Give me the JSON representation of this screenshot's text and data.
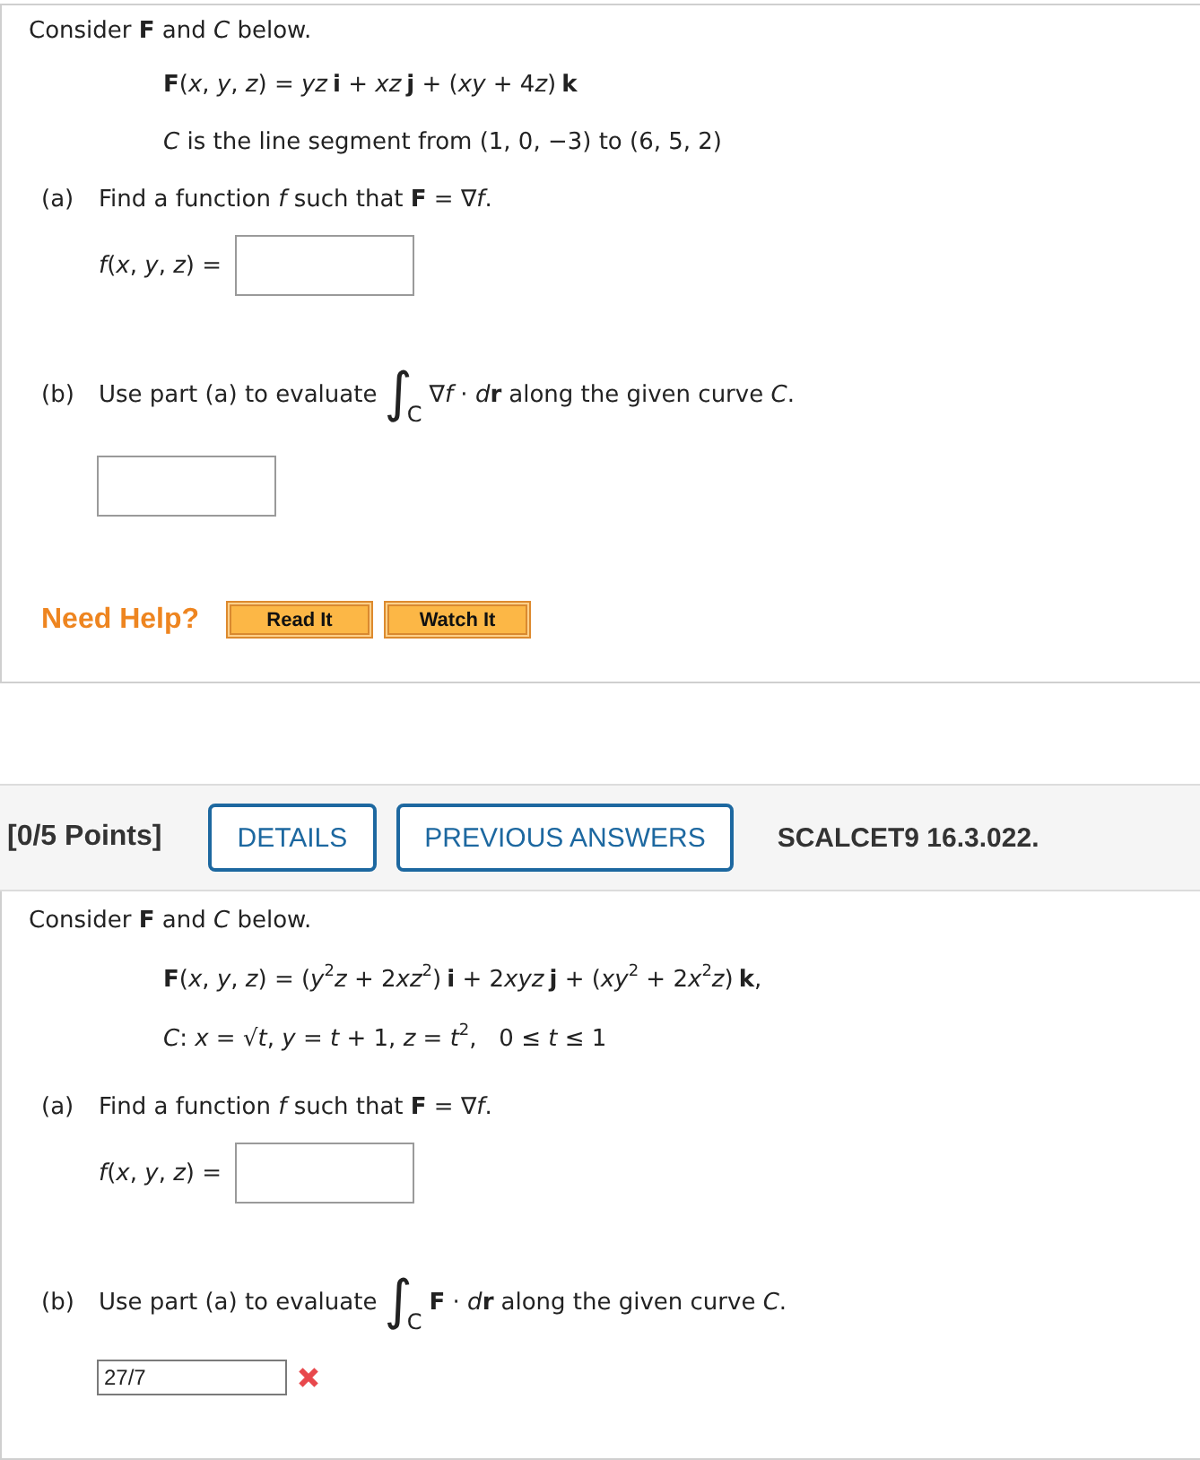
{
  "problems": [
    {
      "intro": "Consider **F** and *C* below.",
      "given": [
        [
          "**F**(*x*, *y*, *z*) = *yz*",
          "**i** + *xz*",
          "**j** + (*xy* + 4",
          "*z*)",
          "**k**"
        ],
        [
          "*C* is the line segment from (1, 0, −3) to (6, 5, 2)"
        ]
      ],
      "parts": [
        {
          "kind": "function",
          "label": "(a)",
          "prompt": "Find a function *f* such that **F** = ∇*f*.",
          "answer_label": "*f*(*x*, *y*, *z*) =",
          "incorrect": false
        },
        {
          "kind": "integral",
          "label": "(b)",
          "prompt": "Use part (a) to evaluate",
          "integral": "∫$_{C}$",
          "integrand": [
            "∇*f* · *d*",
            "**r**"
          ],
          "prompt_end": "along the given curve *C*.",
          "incorrect": false
        }
      ],
      "help": {
        "title": "Need Help?",
        "buttons": [
          "Read It",
          "Watch It"
        ]
      }
    },
    {
      "header": {
        "points": "[0/5 Points]",
        "buttons": [
          "DETAILS",
          "PREVIOUS ANSWERS"
        ],
        "code": "SCALCET9 16.3.022."
      },
      "intro": "Consider **F** and *C* below.",
      "given": [
        [
          "**F**(*x*, *y*, *z*) = (*y*$^{2}$*z* + 2",
          "*xz*$^{2}$)",
          "**i** + 2",
          "*xyz*",
          "**j** + (*xy*$^{2}$ + 2",
          "*x*$^{2}$*z*)",
          "**k**,"
        ],
        [
          "*C*: *x* = √*t*, *y* = *t* + 1, *z* = *t*$^{2}$,   0 ≤ *t* ≤ 1"
        ]
      ],
      "parts": [
        {
          "kind": "function",
          "label": "(a)",
          "prompt": "Find a function *f* such that **F** = ∇*f*.",
          "answer_label": "*f*(*x*, *y*, *z*) =",
          "incorrect": false
        },
        {
          "kind": "integral",
          "label": "(b)",
          "prompt": "Use part (a) to evaluate",
          "integral": "∫$_{C}$",
          "integrand": [
            "**F** · *d*",
            "**r**"
          ],
          "prompt_end": "along the given curve *C*.",
          "answer": "27/7",
          "incorrect": true
        }
      ]
    }
  ]
}
